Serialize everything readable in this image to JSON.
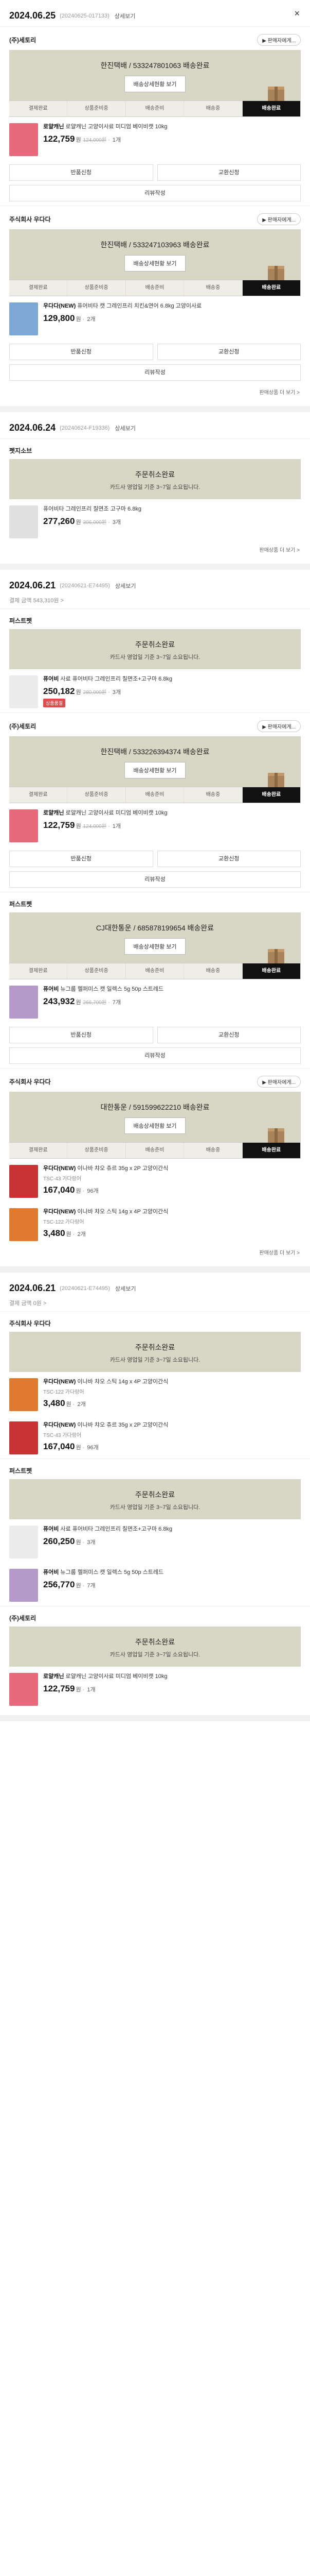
{
  "page": {
    "close_icon": "×"
  },
  "orders": [
    {
      "date": "2024.06.25",
      "order_no": "(20240625-017133)",
      "detail": "상세보기",
      "sub": "",
      "shops": [
        {
          "name": "(주)세토리",
          "talk": "▶ 판매자에게...",
          "status_title": "한진택배 / 533247801063 배송완료",
          "status_desc": "",
          "status_btn": "배송상세현황 보기",
          "steps": [
            "결제완료",
            "상품준비중",
            "배송준비",
            "배송중",
            "배송완료"
          ],
          "active": 4,
          "items": [
            {
              "name_b": "로얄캐닌",
              "name": " 로얄캐닌 고양이사료 미디엄 베이비캣 10kg",
              "opt": "",
              "price": "122,759",
              "unit": "원",
              "strike": "124,000원",
              "qty": "1개",
              "badge": "",
              "thumb": "#e86a7a"
            }
          ],
          "buttons": [
            "반품신청",
            "교환신청",
            "리뷰작성"
          ],
          "more": ""
        },
        {
          "name": "주식회사 우다다",
          "talk": "▶ 판매자에게...",
          "status_title": "한진택배 / 533247103963 배송완료",
          "status_desc": "",
          "status_btn": "배송상세현황 보기",
          "steps": [
            "결제완료",
            "상품준비중",
            "배송준비",
            "배송중",
            "배송완료"
          ],
          "active": 4,
          "items": [
            {
              "name_b": "우다다(NEW)",
              "name": " 퓨어비타 캣 그레인프리 치킨&연어 6.8kg 고양이사료",
              "opt": "",
              "price": "129,800",
              "unit": "원",
              "strike": "",
              "qty": "2개",
              "badge": "",
              "thumb": "#7da8d6"
            }
          ],
          "buttons": [
            "반품신청",
            "교환신청",
            "리뷰작성"
          ],
          "more": "판매상품 더 보기 >"
        }
      ]
    },
    {
      "date": "2024.06.24",
      "order_no": "(20240624-F19336)",
      "detail": "상세보기",
      "sub": "",
      "shops": [
        {
          "name": "펫지소브",
          "talk": "",
          "status_title": "주문취소완료",
          "status_desc": "카드사 영업일 기준 3~7일 소요됩니다.",
          "status_btn": "",
          "steps": [],
          "active": -1,
          "items": [
            {
              "name_b": "",
              "name": "퓨어비타 그레인프리 칠면조 고구마 6.8kg",
              "opt": "",
              "price": "277,260",
              "unit": "원",
              "strike": "306,000원",
              "qty": "3개",
              "badge": "",
              "thumb": "#e0e0e0"
            }
          ],
          "buttons": [],
          "more": "판매상품 더 보기 >"
        }
      ]
    },
    {
      "date": "2024.06.21",
      "order_no": "(20240621-E74495)",
      "detail": "상세보기",
      "sub": "결제 금액 543,310원 >",
      "shops": [
        {
          "name": "퍼스트펫",
          "talk": "",
          "status_title": "주문취소완료",
          "status_desc": "카드사 영업일 기준 3~7일 소요됩니다.",
          "status_btn": "",
          "steps": [],
          "active": -1,
          "items": [
            {
              "name_b": "퓨어비",
              "name": " 사료 퓨어비타 그레인프리 칠면조+고구마 6.8kg",
              "opt": "",
              "price": "250,182",
              "unit": "원",
              "strike": "280,000원",
              "qty": "3개",
              "badge": "상품품절",
              "thumb": "#ececec"
            }
          ],
          "buttons": [],
          "more": ""
        },
        {
          "name": "(주)세토리",
          "talk": "▶ 판매자에게...",
          "status_title": "한진택배 / 533226394374 배송완료",
          "status_desc": "",
          "status_btn": "배송상세현황 보기",
          "steps": [
            "결제완료",
            "상품준비중",
            "배송준비",
            "배송중",
            "배송완료"
          ],
          "active": 4,
          "items": [
            {
              "name_b": "로얄캐닌",
              "name": " 로얄캐닌 고양이사료 미디엄 베이비캣 10kg",
              "opt": "",
              "price": "122,759",
              "unit": "원",
              "strike": "124,000원",
              "qty": "1개",
              "badge": "",
              "thumb": "#e86a7a"
            }
          ],
          "buttons": [
            "반품신청",
            "교환신청",
            "리뷰작성"
          ],
          "more": ""
        },
        {
          "name": "퍼스트펫",
          "talk": "",
          "status_title": "CJ대한통운 / 685878199654 배송완료",
          "status_desc": "",
          "status_btn": "배송상세현황 보기",
          "steps": [
            "결제완료",
            "상품준비중",
            "배송준비",
            "배송중",
            "배송완료"
          ],
          "active": 4,
          "items": [
            {
              "name_b": "퓨어비",
              "name": " 뉴그룹 헬퍼미스 캣 일렉스 5g 50p 스트레드",
              "opt": "",
              "price": "243,932",
              "unit": "원",
              "strike": "266,700원",
              "qty": "7개",
              "badge": "",
              "thumb": "#b49acb"
            }
          ],
          "buttons": [
            "반품신청",
            "교환신청",
            "리뷰작성"
          ],
          "more": ""
        },
        {
          "name": "주식회사 우다다",
          "talk": "▶ 판매자에게...",
          "status_title": "대한통운 / 591599622210 배송완료",
          "status_desc": "",
          "status_btn": "배송상세현황 보기",
          "steps": [
            "결제완료",
            "상품준비중",
            "배송준비",
            "배송중",
            "배송완료"
          ],
          "active": 4,
          "items": [
            {
              "name_b": "우다다(NEW)",
              "name": " 이나바 챠오 츄르 35g x 2P 고양이간식",
              "opt": "TSC-43 가다랑어",
              "price": "167,040",
              "unit": "원",
              "strike": "",
              "qty": "96개",
              "badge": "",
              "thumb": "#c83232"
            },
            {
              "name_b": "우다다(NEW)",
              "name": " 이나바 챠오 스틱 14g x 4P 고양이간식",
              "opt": "TSC-122 가다랑어",
              "price": "3,480",
              "unit": "원",
              "strike": "",
              "qty": "2개",
              "badge": "",
              "thumb": "#e07a2e"
            }
          ],
          "buttons": [],
          "more": "판매상품 더 보기 >"
        }
      ]
    },
    {
      "date": "2024.06.21",
      "order_no": "(20240621-E74495)",
      "detail": "상세보기",
      "sub": "결제 금액 0원 >",
      "shops": [
        {
          "name": "주식회사 우다다",
          "talk": "",
          "status_title": "주문취소완료",
          "status_desc": "카드사 영업일 기준 3~7일 소요됩니다.",
          "status_btn": "",
          "steps": [],
          "active": -1,
          "items": [
            {
              "name_b": "우다다(NEW)",
              "name": " 이나바 챠오 스틱 14g x 4P 고양이간식",
              "opt": "TSC-122 가다랑어",
              "price": "3,480",
              "unit": "원",
              "strike": "",
              "qty": "2개",
              "badge": "",
              "thumb": "#e07a2e"
            },
            {
              "name_b": "우다다(NEW)",
              "name": " 이나바 챠오 츄르 35g x 2P 고양이간식",
              "opt": "TSC-43 가다랑어",
              "price": "167,040",
              "unit": "원",
              "strike": "",
              "qty": "96개",
              "badge": "",
              "thumb": "#c83232"
            }
          ],
          "buttons": [],
          "more": ""
        },
        {
          "name": "퍼스트펫",
          "talk": "",
          "status_title": "주문취소완료",
          "status_desc": "카드사 영업일 기준 3~7일 소요됩니다.",
          "status_btn": "",
          "steps": [],
          "active": -1,
          "items": [
            {
              "name_b": "퓨어비",
              "name": " 사료 퓨어비타 그레인프리 칠면조+고구마 6.8kg",
              "opt": "",
              "price": "260,250",
              "unit": "원",
              "strike": "",
              "qty": "3개",
              "badge": "",
              "thumb": "#ececec"
            },
            {
              "name_b": "퓨어비",
              "name": " 뉴그룹 헬퍼미스 캣 일렉스 5g 50p 스트레드",
              "opt": "",
              "price": "256,770",
              "unit": "원",
              "strike": "",
              "qty": "7개",
              "badge": "",
              "thumb": "#b49acb"
            }
          ],
          "buttons": [],
          "more": ""
        },
        {
          "name": "(주)세토리",
          "talk": "",
          "status_title": "주문취소완료",
          "status_desc": "카드사 영업일 기준 3~7일 소요됩니다.",
          "status_btn": "",
          "steps": [],
          "active": -1,
          "items": [
            {
              "name_b": "로얄캐닌",
              "name": " 로얄캐닌 고양이사료 미디엄 베이비캣 10kg",
              "opt": "",
              "price": "122,759",
              "unit": "원",
              "strike": "",
              "qty": "1개",
              "badge": "",
              "thumb": "#e86a7a"
            }
          ],
          "buttons": [],
          "more": ""
        }
      ]
    }
  ]
}
